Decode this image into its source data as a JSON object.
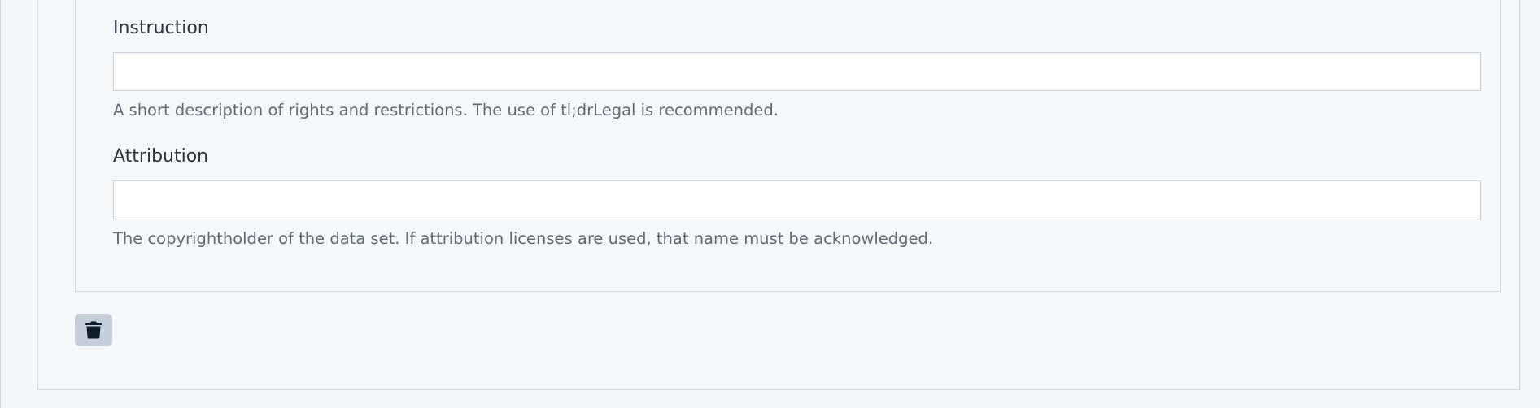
{
  "form": {
    "instruction": {
      "label": "Instruction",
      "value": "",
      "help": "A short description of rights and restrictions. The use of tl;drLegal is recommended."
    },
    "attribution": {
      "label": "Attribution",
      "value": "",
      "help": "The copyrightholder of the data set. If attribution licenses are used, that name must be acknowledged."
    }
  },
  "actions": {
    "delete_icon": "trash-icon"
  },
  "colors": {
    "background": "#f4f7fa",
    "border": "#d0dae3",
    "delete_button_bg": "#c3ced8",
    "icon": "#0d1b2a"
  }
}
